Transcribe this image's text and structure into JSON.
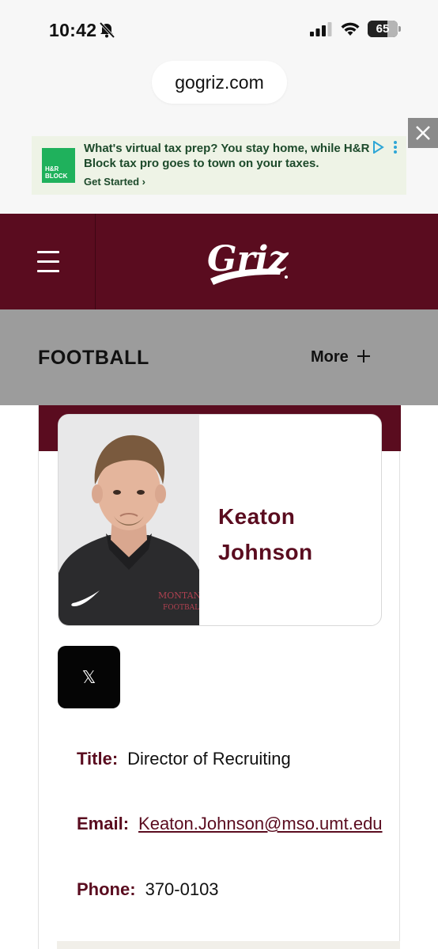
{
  "status_bar": {
    "time": "10:42",
    "battery_level": "65",
    "battery_fraction": 0.65,
    "icons": [
      "bell-off-icon",
      "cellular-signal-icon",
      "wifi-icon",
      "battery-icon"
    ]
  },
  "browser": {
    "url": "gogriz.com"
  },
  "ad": {
    "logo_text": "H&R BLOCK",
    "headline": "What's virtual tax prep? You stay home, while H&R Block tax pro goes to town on your taxes.",
    "cta": "Get Started ›",
    "icons": [
      "adchoices-icon",
      "kebab-menu-icon",
      "close-icon"
    ],
    "brand_color": "#1fb15c"
  },
  "header": {
    "logo_text": "Griz",
    "icons": [
      "hamburger-menu-icon"
    ],
    "brand_color": "#5a0c1f"
  },
  "sport_nav": {
    "title": "FOOTBALL",
    "more_label": "More",
    "icons": [
      "plus-icon"
    ]
  },
  "profile": {
    "first_name": "Keaton",
    "last_name": "Johnson",
    "photo_shirt_text": [
      "MONTAN",
      "FOOTBALL"
    ],
    "social_icon": "x-icon",
    "social_label": "𝕏",
    "fields": {
      "title_label": "Title:",
      "title_value": "Director of Recruiting",
      "email_label": "Email:",
      "email_value": "Keaton.Johnson@mso.umt.edu",
      "phone_label": "Phone:",
      "phone_value": "370-0103"
    }
  }
}
